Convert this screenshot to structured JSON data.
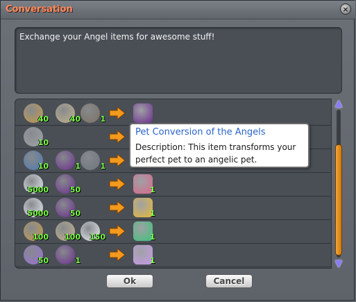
{
  "window": {
    "title": "Conversation",
    "close_label": "×"
  },
  "message": "Exchange your Angel items for awesome stuff!",
  "rows": [
    {
      "costs": [
        {
          "icon": "angel-feather-icon",
          "qty": "40",
          "color": "#c69a4a"
        },
        {
          "icon": "stone-icon",
          "qty": "40",
          "color": "#c4b38a"
        },
        {
          "icon": "box-icon",
          "qty": "1",
          "color": "#7d7162"
        }
      ],
      "reward": {
        "icon": "purple-hat-icon",
        "qty": "",
        "color": "#6b2d8e"
      }
    },
    {
      "costs": [
        {
          "icon": "gray-stone-icon",
          "qty": "10",
          "color": "#9fa3a8"
        }
      ],
      "reward": {
        "icon": "",
        "qty": "",
        "color": ""
      }
    },
    {
      "costs": [
        {
          "icon": "shield-icon",
          "qty": "10",
          "color": "#4f79b0"
        },
        {
          "icon": "purple-hat-icon",
          "qty": "1",
          "color": "#6b2d8e"
        },
        {
          "icon": "statue-icon",
          "qty": "1",
          "color": "#6d757d"
        }
      ],
      "reward": {
        "icon": "",
        "qty": "",
        "color": ""
      }
    },
    {
      "costs": [
        {
          "icon": "angel-wings-icon",
          "qty": "5000",
          "color": "#e9edf2"
        },
        {
          "icon": "purple-hat-icon",
          "qty": "50",
          "color": "#6b2d8e"
        }
      ],
      "reward": {
        "icon": "pet-conversion-icon",
        "qty": "1",
        "color": "#d9688a"
      }
    },
    {
      "costs": [
        {
          "icon": "angel-wings-icon",
          "qty": "5000",
          "color": "#e9edf2"
        },
        {
          "icon": "purple-hat-icon",
          "qty": "50",
          "color": "#6b2d8e"
        }
      ],
      "reward": {
        "icon": "golden-sword-icon",
        "qty": "1",
        "color": "#e6b83b"
      }
    },
    {
      "costs": [
        {
          "icon": "angel-feather-icon",
          "qty": "100",
          "color": "#c69a4a"
        },
        {
          "icon": "stone-icon",
          "qty": "100",
          "color": "#c4b38a"
        },
        {
          "icon": "angel-wings-icon",
          "qty": "150",
          "color": "#e9edf2"
        }
      ],
      "reward": {
        "icon": "green-orb-icon",
        "qty": "1",
        "color": "#3ec27a"
      }
    },
    {
      "costs": [
        {
          "icon": "purple-orb-icon",
          "qty": "50",
          "color": "#9a6fd6"
        },
        {
          "icon": "purple-hat-icon",
          "qty": "1",
          "color": "#6b2d8e"
        }
      ],
      "reward": {
        "icon": "angel-pet-icon",
        "qty": "1",
        "color": "#c79ae8"
      }
    }
  ],
  "tooltip": {
    "title": "Pet Conversion of the Angels",
    "description": "Description: This item transforms your perfect pet to an angelic pet."
  },
  "buttons": {
    "ok": "Ok",
    "cancel": "Cancel"
  },
  "colors": {
    "title": "#ff8a5c",
    "quantity": "#7cff4a",
    "arrow": "#f39a1e",
    "tooltip_title": "#2b63c9"
  }
}
